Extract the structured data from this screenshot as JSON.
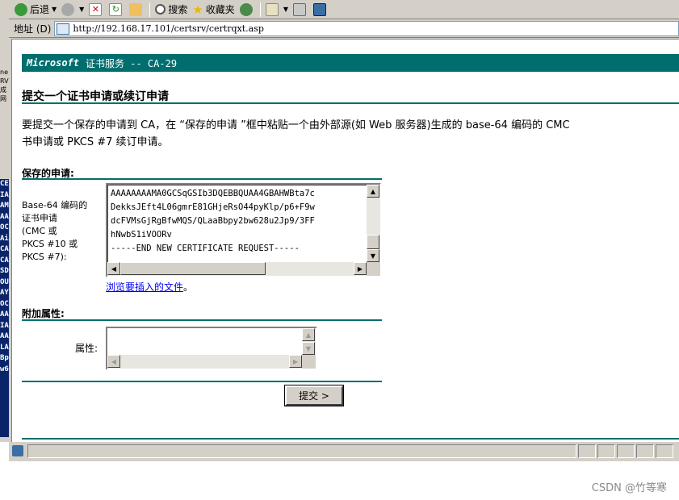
{
  "toolbar": {
    "back_label": "后退",
    "search_label": "搜索",
    "favorites_label": "收藏夹"
  },
  "address": {
    "label": "地址 (D)",
    "url": "http://192.168.17.101/certsrv/certrqxt.asp"
  },
  "page": {
    "header_brand": "Microsoft",
    "header_service": "证书服务 --  CA-29",
    "title": "提交一个证书申请或续订申请",
    "intro_line1": "要提交一个保存的申请到 CA，在 “保存的申请 ”框中粘贴一个由外部源(如 Web 服务器)生成的 base-64 编码的 CMC",
    "intro_line2": "书申请或 PKCS #7 续订申请。",
    "saved_request_heading": "保存的申请:",
    "request_label_lines": [
      "Base-64 编码的",
      "证书申请",
      "(CMC 或",
      "PKCS #10 或",
      "PKCS #7):"
    ],
    "request_text_lines": [
      "AAAAAAAAMA0GCSqGSIb3DQEBBQUAA4GBAHWBta7c",
      "DekksJEft4L06gmrE81GHjeRsO44pyKlp/p6+F9w",
      "dcFVMsGjRgBfwMQS/QLaaBbpy2bw628u2Jp9/3FF",
      "hNwbS1iVOORv",
      "-----END NEW CERTIFICATE REQUEST-----"
    ],
    "browse_link": "浏览要插入的文件",
    "browse_suffix": "。",
    "additional_attributes_heading": "附加属性:",
    "attributes_label": "属性:",
    "attributes_value": "",
    "submit_label": "提交 >"
  },
  "background_window": {
    "gray_fragments": [
      "ne",
      "RV",
      "成",
      "网"
    ],
    "blue_fragments": [
      "CE",
      "IA",
      "AM",
      "AA",
      "OC",
      "Ai",
      "CA",
      "CA",
      "SD",
      "OU",
      "AY",
      "OC",
      "AA",
      "IA",
      "AA",
      "LA",
      "Bp",
      "w6"
    ]
  },
  "watermark": "CSDN @竹等寒",
  "colors": {
    "accent": "#006e6e",
    "chrome": "#d4d0c8",
    "link": "#0000ee"
  }
}
